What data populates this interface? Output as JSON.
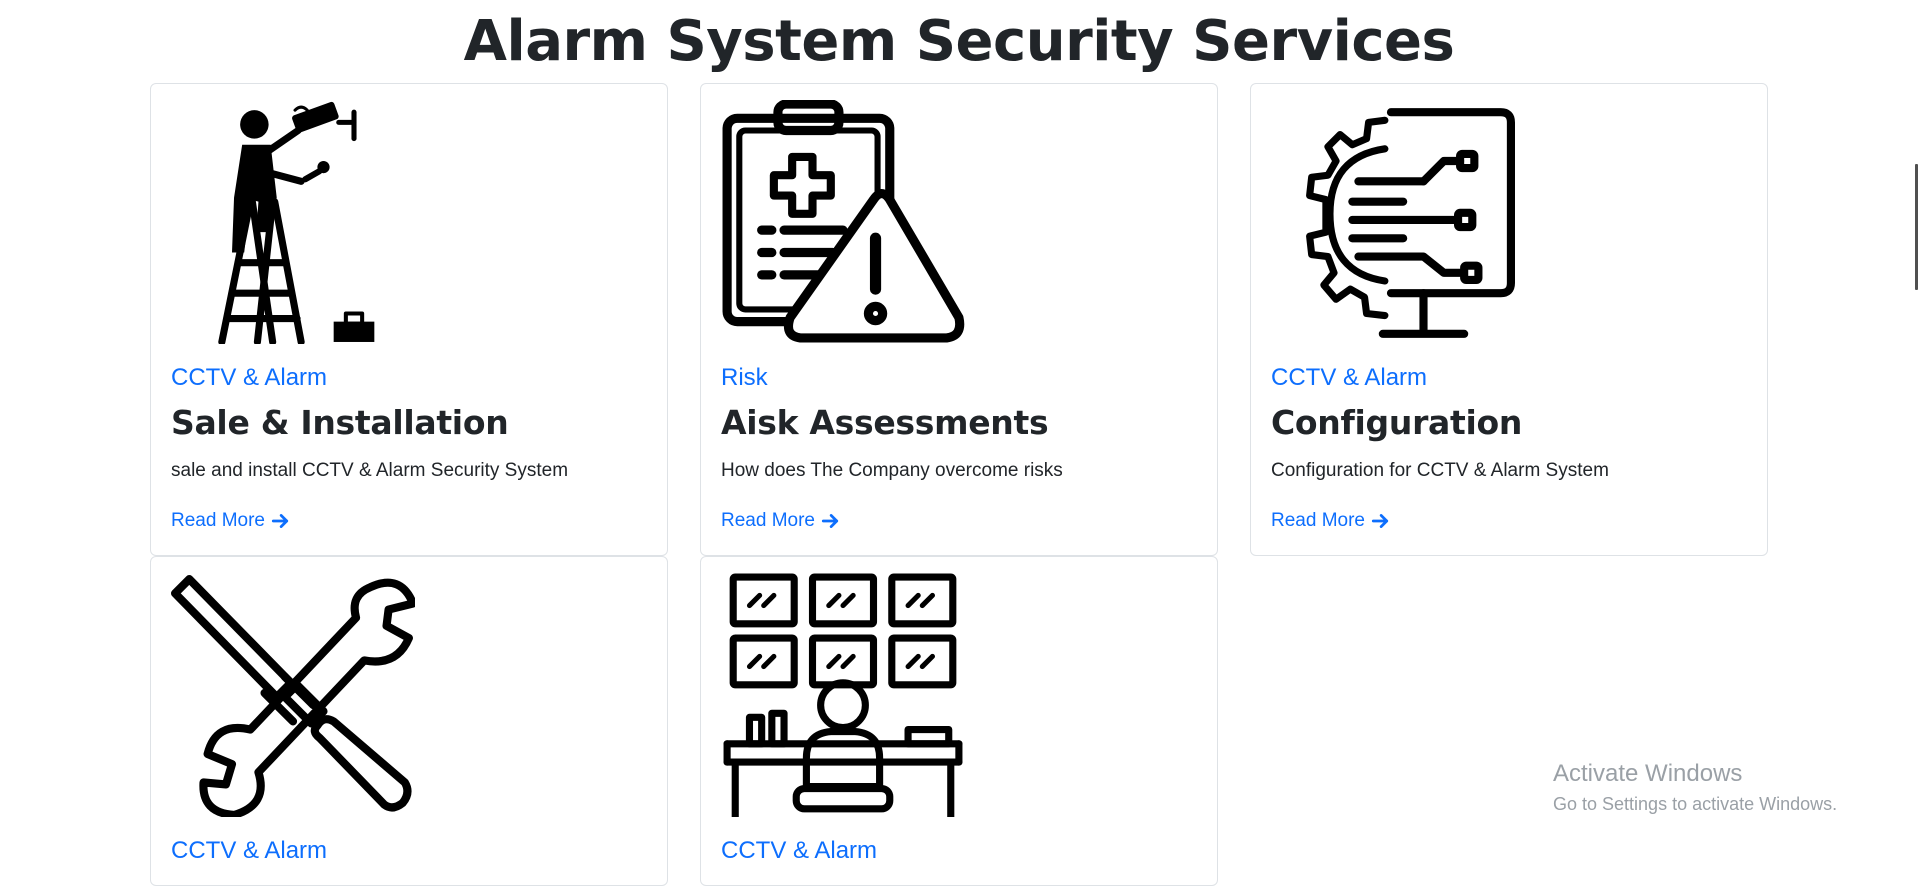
{
  "page": {
    "title": "Alarm System Security Services"
  },
  "cards": [
    {
      "category": "CCTV & Alarm",
      "title": "Sale & Installation",
      "desc": "sale and install CCTV & Alarm Security System",
      "more": "Read More",
      "icon": "technician-on-ladder-icon"
    },
    {
      "category": "Risk",
      "title": "Aisk Assessments",
      "desc": "How does The Company overcome risks",
      "more": "Read More",
      "icon": "clipboard-warning-icon"
    },
    {
      "category": "CCTV & Alarm",
      "title": "Configuration",
      "desc": "Configuration for CCTV & Alarm System",
      "more": "Read More",
      "icon": "monitor-gear-circuit-icon"
    },
    {
      "category": "CCTV & Alarm",
      "icon": "wrench-screwdriver-icon"
    },
    {
      "category": "CCTV & Alarm",
      "icon": "surveillance-room-icon"
    }
  ],
  "watermark": {
    "line1": "Activate Windows",
    "line2": "Go to Settings to activate Windows."
  },
  "colors": {
    "link": "#0d6efd",
    "text": "#212529",
    "border": "#dee2e6"
  }
}
